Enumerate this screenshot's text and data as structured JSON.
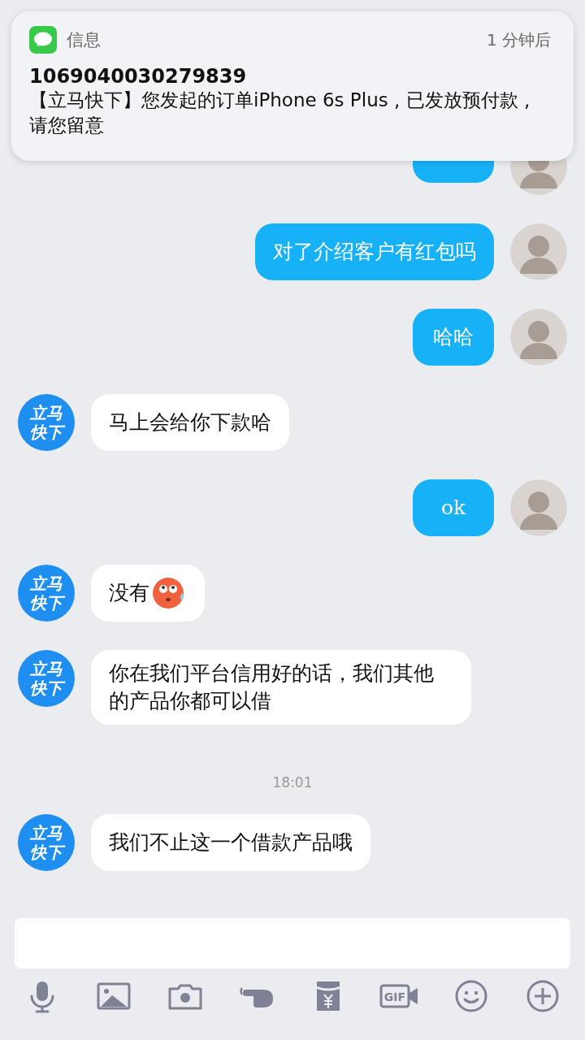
{
  "notification": {
    "app": "信息",
    "time": "1 分钟后",
    "sender": "1069040030279839",
    "body": "【立马快下】您发起的订单iPhone 6s Plus , 已发放预付款 , 请您留意"
  },
  "messages": [
    {
      "kind": "sent"
    },
    {
      "kind": "sent",
      "text": "对了介绍客户有红包吗"
    },
    {
      "kind": "sent",
      "text": "哈哈"
    },
    {
      "kind": "received",
      "avatar": "立马快下",
      "text": "马上会给你下款哈"
    },
    {
      "kind": "sent",
      "text": "ok"
    },
    {
      "kind": "received",
      "avatar": "立马快下",
      "text": "没有",
      "emoji": true
    },
    {
      "kind": "received",
      "avatar": "立马快下",
      "text": "你在我们平台信用好的话，我们其他的产品你都可以借"
    },
    {
      "kind": "time",
      "text": "18:01"
    },
    {
      "kind": "received",
      "avatar": "立马快下",
      "text": "我们不止这一个借款产品哦"
    }
  ],
  "toolbar": [
    {
      "kind": "mic"
    },
    {
      "kind": "image"
    },
    {
      "kind": "camera"
    },
    {
      "kind": "poke"
    },
    {
      "kind": "redpacket"
    },
    {
      "kind": "gif",
      "label": "GIF"
    },
    {
      "kind": "emoji"
    },
    {
      "kind": "plus"
    }
  ]
}
